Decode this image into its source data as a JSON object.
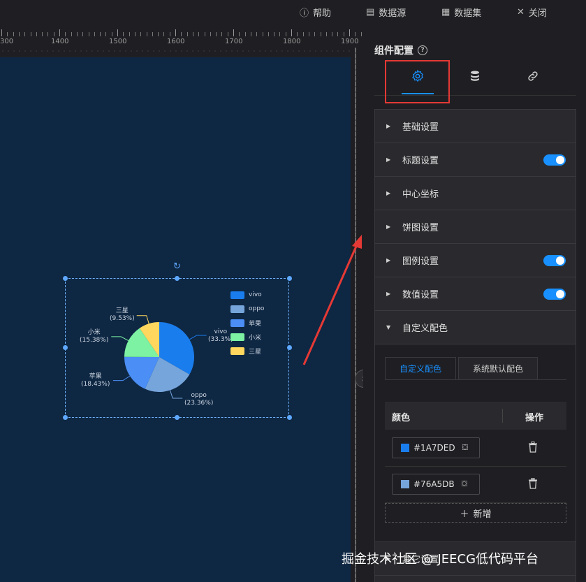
{
  "topbar": {
    "help": {
      "label": "帮助",
      "icon": "info-icon"
    },
    "datasource": {
      "label": "数据源",
      "icon": "datasource-icon"
    },
    "dataset": {
      "label": "数据集",
      "icon": "dataset-icon"
    },
    "close": {
      "label": "关闭",
      "icon": "close-icon"
    }
  },
  "ruler": {
    "labels": [
      "300",
      "1400",
      "1500",
      "1600",
      "1700",
      "1800",
      "1900"
    ]
  },
  "panel": {
    "title": "组件配置",
    "tabs": [
      {
        "icon": "gear-icon",
        "active": true
      },
      {
        "icon": "database-icon",
        "active": false
      },
      {
        "icon": "link-icon",
        "active": false
      }
    ],
    "sections": [
      {
        "label": "基础设置",
        "toggle": false
      },
      {
        "label": "标题设置",
        "toggle": true
      },
      {
        "label": "中心坐标",
        "toggle": false
      },
      {
        "label": "饼图设置",
        "toggle": false
      },
      {
        "label": "图例设置",
        "toggle": true
      },
      {
        "label": "数值设置",
        "toggle": true
      },
      {
        "label": "自定义配色",
        "toggle": false,
        "expanded": true
      },
      {
        "label": "其它设置",
        "toggle": false
      }
    ],
    "custom_color": {
      "subtabs": [
        "自定义配色",
        "系统默认配色"
      ],
      "headers": {
        "color": "颜色",
        "action": "操作"
      },
      "rows": [
        {
          "hex": "#1A7DED",
          "swatch": "#1A7DED"
        },
        {
          "hex": "#76A5DB",
          "swatch": "#76A5DB"
        }
      ],
      "add_label": "新增"
    }
  },
  "chart_data": {
    "type": "pie",
    "legend_position": "right",
    "series": [
      {
        "name": "vivo",
        "percent": 33.3,
        "color": "#1A7DED"
      },
      {
        "name": "oppo",
        "percent": 23.36,
        "color": "#76A5DB"
      },
      {
        "name": "苹果",
        "percent": 18.43,
        "color": "#4B8EF5"
      },
      {
        "name": "小米",
        "percent": 15.38,
        "color": "#7CF2A2"
      },
      {
        "name": "三星",
        "percent": 9.53,
        "color": "#FFD75E"
      }
    ],
    "labels": [
      {
        "name": "vivo",
        "pct": "(33.3%)"
      },
      {
        "name": "oppo",
        "pct": "(23.36%)"
      },
      {
        "name": "苹果",
        "pct": "(18.43%)"
      },
      {
        "name": "小米",
        "pct": "(15.38%)"
      },
      {
        "name": "三星",
        "pct": "(9.53%)"
      }
    ]
  },
  "watermark": "掘金技术社区 @ JEECG低代码平台"
}
